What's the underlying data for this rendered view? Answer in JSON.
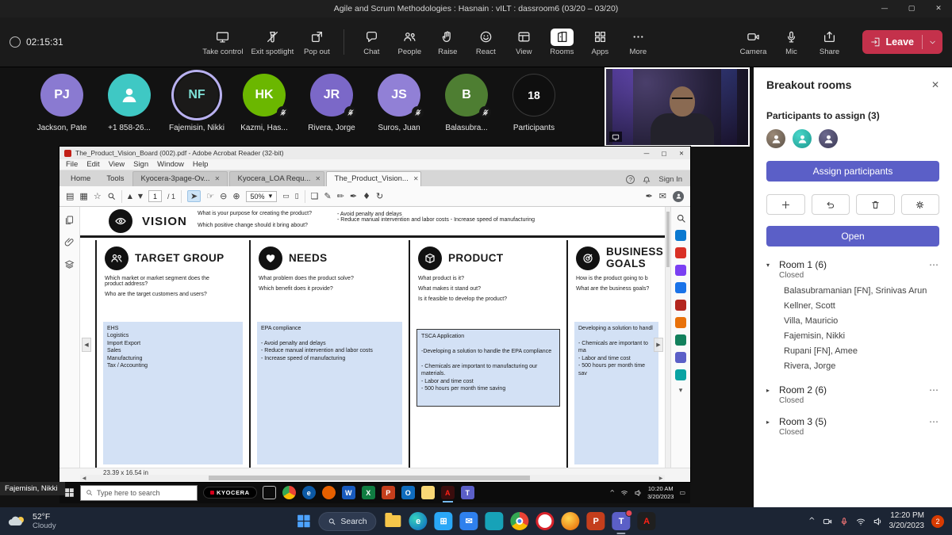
{
  "window": {
    "title": "Agile and Scrum Methodologies : Hasnain : vILT : dassroom6 (03/20 – 03/20)"
  },
  "call_toolbar": {
    "timer": "02:15:31",
    "buttons": [
      {
        "label": "Take control"
      },
      {
        "label": "Exit spotlight"
      },
      {
        "label": "Pop out"
      },
      {
        "label": "Chat"
      },
      {
        "label": "People"
      },
      {
        "label": "Raise"
      },
      {
        "label": "React"
      },
      {
        "label": "View"
      },
      {
        "label": "Rooms"
      },
      {
        "label": "Apps"
      },
      {
        "label": "More"
      }
    ],
    "device_buttons": [
      {
        "label": "Camera"
      },
      {
        "label": "Mic"
      },
      {
        "label": "Share"
      }
    ],
    "leave_label": "Leave"
  },
  "participants_strip": [
    {
      "initials": "PJ",
      "name": "Jackson, Pate"
    },
    {
      "initials": "",
      "name": "+1 858-26..."
    },
    {
      "initials": "NF",
      "name": "Fajemisin, Nikki"
    },
    {
      "initials": "HK",
      "name": "Kazmi, Has..."
    },
    {
      "initials": "JR",
      "name": "Rivera, Jorge"
    },
    {
      "initials": "JS",
      "name": "Suros, Juan"
    },
    {
      "initials": "B",
      "name": "Balasubra..."
    },
    {
      "count": "18",
      "name": "Participants"
    }
  ],
  "breakout_panel": {
    "title": "Breakout rooms",
    "assign_header": "Participants to assign (3)",
    "assign_button": "Assign participants",
    "open_button": "Open",
    "rooms": [
      {
        "name": "Room 1 (6)",
        "status": "Closed",
        "members": [
          "Balasubramanian [FN], Srinivas Arun",
          "Kellner, Scott",
          "Villa, Mauricio",
          "Fajemisin, Nikki",
          "Rupani [FN], Amee",
          "Rivera, Jorge"
        ]
      },
      {
        "name": "Room 2 (6)",
        "status": "Closed",
        "members": []
      },
      {
        "name": "Room 3 (5)",
        "status": "Closed",
        "members": []
      }
    ]
  },
  "acrobat": {
    "window_title": "The_Product_Vision_Board (002).pdf - Adobe Acrobat Reader (32-bit)",
    "menu": [
      "File",
      "Edit",
      "View",
      "Sign",
      "Window",
      "Help"
    ],
    "tabs": [
      "Home",
      "Tools",
      "Kyocera-3page-Ov...",
      "Kyocera_LOA Requ...",
      "The_Product_Vision..."
    ],
    "sign_in": "Sign In",
    "page_current": "1",
    "page_of": "/ 1",
    "zoom_level": "50%",
    "size_status": "23.39 x 16.54 in",
    "board": {
      "vision": {
        "title": "VISION",
        "q1": "What is your purpose for creating the product?",
        "q2": "Which positive change should it bring about?",
        "answer": "- Avoid penalty and delays\n- Reduce manual intervention and labor costs - Increase speed of manufacturing"
      },
      "columns": [
        {
          "title": "TARGET GROUP",
          "q1": "Which market or market segment does the product address?",
          "q2": "Who are the target customers and users?",
          "q3": "",
          "answer": "EHS\nLogistics\nImport Export\nSales\nManufacturing\nTax / Accounting"
        },
        {
          "title": "NEEDS",
          "q1": "What problem does the product solve?",
          "q2": "Which benefit does it provide?",
          "q3": "",
          "answer": "EPA compliance\n\n- Avoid penalty and delays\n- Reduce manual intervention and labor costs\n- Increase speed of manufacturing"
        },
        {
          "title": "PRODUCT",
          "q1": "What product is it?",
          "q2": "What makes it stand out?",
          "q3": "Is it feasible to develop the product?",
          "answer": "TSCA Application\n\n-Developing a solution to handle the EPA compliance\n\n- Chemicals are important to manufacturing our materials.\n- Labor and time cost\n- 500 hours per month time saving"
        },
        {
          "title": "BUSINESS GOALS",
          "q1": "How is the product going to b",
          "q2": "What are the business goals?",
          "q3": "",
          "answer": "Developing a solution to handl\n\n- Chemicals are important to ma\n- Labor and time cost\n- 500 hours per month time sav"
        }
      ]
    }
  },
  "shared_screen": {
    "presenter_label": "Fajemisin, Nikki",
    "taskbar": {
      "search_placeholder": "Type here to search",
      "brand": "KYOCERA",
      "time": "10:20 AM",
      "date": "3/20/2023"
    }
  },
  "host_taskbar": {
    "weather_temp": "52°F",
    "weather_desc": "Cloudy",
    "search_label": "Search",
    "time": "12:20 PM",
    "date": "3/20/2023",
    "notification_count": "2"
  },
  "icons": {
    "close": "✕",
    "minimize": "—",
    "maximize": "▢",
    "chevron_down": "▾",
    "chevron_right": "▸",
    "chevron_up": "^",
    "more_h": "⋯",
    "star": "☆",
    "save": "▤",
    "print": "▦",
    "page_prev": "▲",
    "page_next": "▼",
    "pointer": "➤",
    "hand": "☞",
    "zoom_out": "⊖",
    "zoom_in": "⊕",
    "fit_width": "▭",
    "fit_page": "▯",
    "comment": "❏",
    "highlight": "✎",
    "draw": "✏",
    "sign_pen": "✒",
    "stamp": "♦",
    "mail": "✉",
    "refresh": "↻",
    "arrow_left": "◀",
    "arrow_right": "▶"
  },
  "colors": {
    "accent_blue": "#5b5fc7",
    "leave_red": "#c4314b",
    "answer_box_blue": "#d3e1f5",
    "avatar_purple": "#8a7ad1",
    "avatar_teal": "#3fc8c4",
    "avatar_green": "#6bb700",
    "avatar_dark_green": "#4e7e32",
    "avatar_black": "#1b1a19",
    "notification_orange": "#d83b01"
  }
}
